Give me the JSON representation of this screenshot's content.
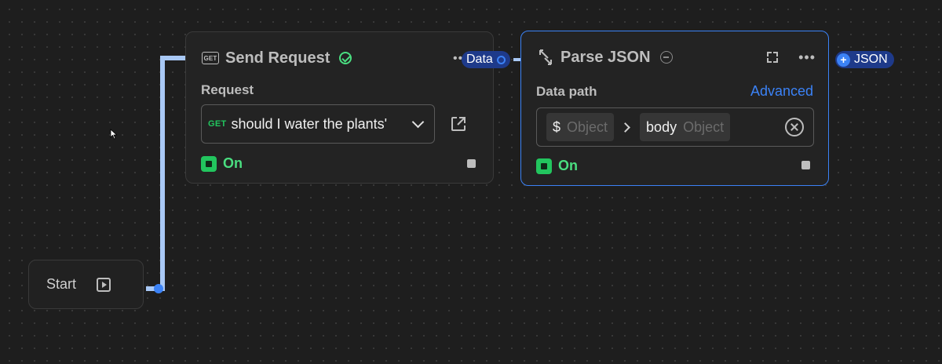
{
  "canvas": {
    "background": "#1e1e1e",
    "edge_color": "#a8c8f5",
    "accent": "#3b82f6"
  },
  "start_node": {
    "label": "Start",
    "icon": "play-icon"
  },
  "send_request_node": {
    "title": "Send Request",
    "badge_icon_text": "GET",
    "status_icon": "check-circle-icon",
    "section_label": "Request",
    "method": "GET",
    "request_name": "should I water the plants'",
    "toggle_label": "On",
    "output_port_label": "Data"
  },
  "parse_json_node": {
    "title": "Parse JSON",
    "status_icon": "minus-circle-icon",
    "section_label": "Data path",
    "advanced_label": "Advanced",
    "path": [
      {
        "key": "$",
        "type": "Object"
      },
      {
        "key": "body",
        "type": "Object"
      }
    ],
    "toggle_label": "On",
    "output_port_label": "JSON"
  }
}
